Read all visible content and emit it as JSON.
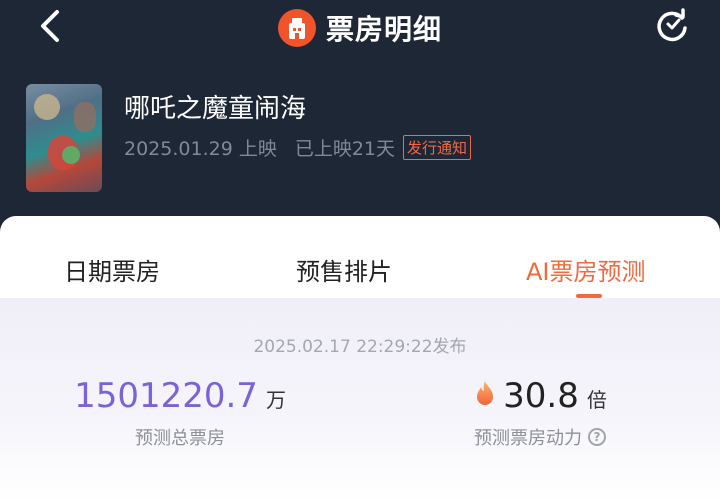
{
  "header": {
    "title": "票房明细"
  },
  "movie": {
    "name": "哪吒之魔童闹海",
    "release_date": "2025.01.29 上映",
    "days_released": "已上映21天",
    "release_notice": "发行通知"
  },
  "tabs": [
    {
      "label": "日期票房"
    },
    {
      "label": "预售排片"
    },
    {
      "label": "AI票房预测"
    }
  ],
  "forecast": {
    "published": "2025.02.17 22:29:22发布",
    "total_value": "1501220.7",
    "total_unit": "万",
    "total_label": "预测总票房",
    "momentum_value": "30.8",
    "momentum_unit": "倍",
    "momentum_label": "预测票房动力"
  },
  "colors": {
    "accent": "#f06a3e",
    "value_purple": "#7b62d6",
    "header_bg": "#1d2735"
  },
  "icons": [
    "back-arrow-icon",
    "cinema-logo-icon",
    "refresh-icon",
    "fire-icon",
    "help-icon"
  ]
}
